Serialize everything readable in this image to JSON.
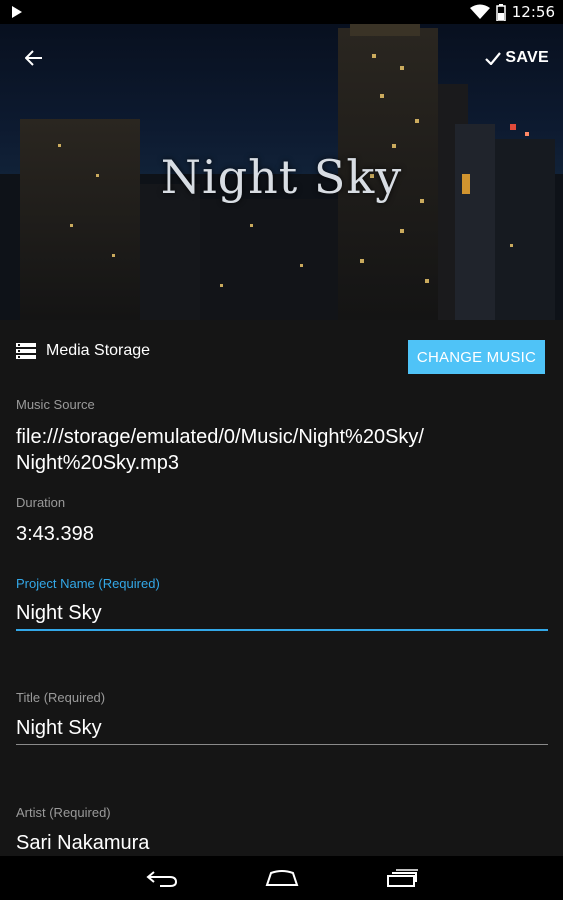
{
  "status_bar": {
    "time": "12:56",
    "icons": [
      "play-icon",
      "wifi-icon",
      "battery-icon"
    ]
  },
  "header": {
    "cover_title": "Night Sky",
    "back_icon": "arrow-back-icon",
    "save_label": "SAVE",
    "save_icon": "checkmark-icon"
  },
  "media": {
    "storage_label": "Media Storage",
    "storage_icon": "storage-list-icon",
    "change_button_label": "CHANGE MUSIC",
    "accent_color": "#4fc3f7"
  },
  "fields": {
    "music_source": {
      "label": "Music Source",
      "value_line1": "file:///storage/emulated/0/Music/Night%20Sky/",
      "value_line2": "Night%20Sky.mp3"
    },
    "duration": {
      "label": "Duration",
      "value": "3:43.398"
    },
    "project_name": {
      "label": "Project Name (Required)",
      "value": "Night Sky"
    },
    "title": {
      "label": "Title (Required)",
      "value": "Night Sky"
    },
    "artist": {
      "label": "Artist (Required)",
      "value": "Sari Nakamura"
    }
  },
  "nav_bar": {
    "icons": [
      "nav-back-icon",
      "nav-home-icon",
      "nav-recents-icon"
    ]
  }
}
